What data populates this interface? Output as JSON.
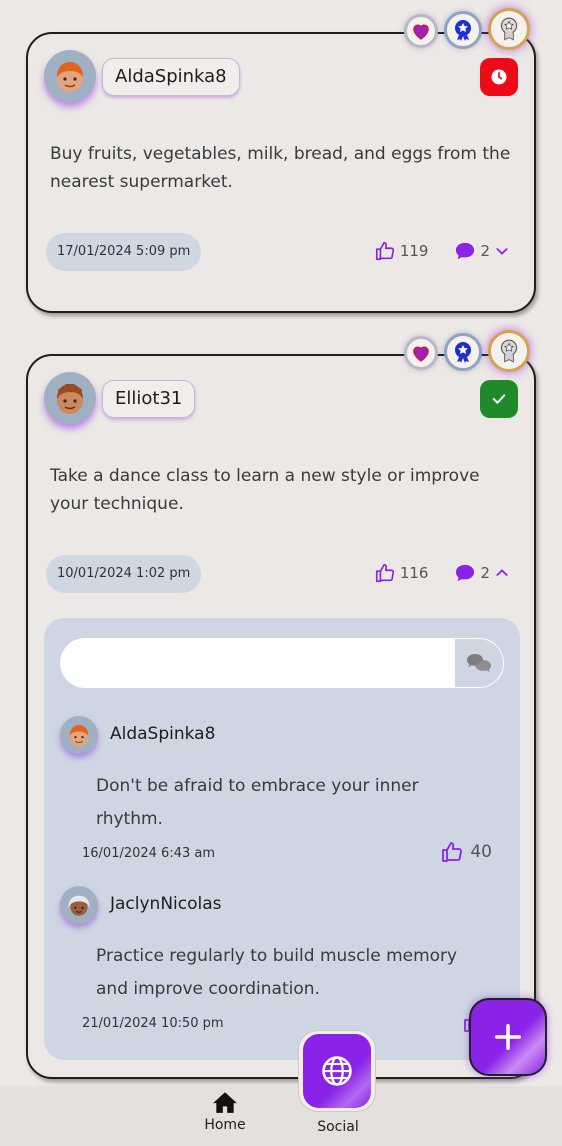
{
  "posts": [
    {
      "username": "AldaSpinka8",
      "text": "Buy fruits, vegetables, milk, bread, and eggs from the nearest supermarket.",
      "date": "17/01/2024 5:09 pm",
      "likes": "119",
      "comments": "2",
      "status": "pending",
      "expanded": false
    },
    {
      "username": "Elliot31",
      "text": "Take a dance class to learn a new style or improve your technique.",
      "date": "10/01/2024 1:02 pm",
      "likes": "116",
      "comments": "2",
      "status": "done",
      "expanded": true,
      "comment_input": {
        "value": "",
        "placeholder": ""
      },
      "comment_list": [
        {
          "username": "AldaSpinka8",
          "text": "Don't be afraid to embrace your inner rhythm.",
          "date": "16/01/2024 6:43 am",
          "likes": "40"
        },
        {
          "username": "JaclynNicolas",
          "text": "Practice regularly to build muscle memory and improve coordination.",
          "date": "21/01/2024 10:50 pm",
          "likes": ""
        }
      ]
    }
  ],
  "nav": {
    "home_label": "Home",
    "social_label": "Social"
  },
  "colors": {
    "accent": "#8a22e8",
    "pending": "#ee0b18",
    "done": "#1e8a2a",
    "panel": "#cdd6e2"
  },
  "icons": [
    "heart-badge-icon",
    "star-badge-icon",
    "ribbon-badge-icon",
    "clock-icon",
    "check-icon",
    "thumbs-up-icon",
    "comment-icon",
    "chevron-down-icon",
    "chevron-up-icon",
    "chat-send-icon",
    "plus-icon",
    "home-icon",
    "globe-icon"
  ]
}
